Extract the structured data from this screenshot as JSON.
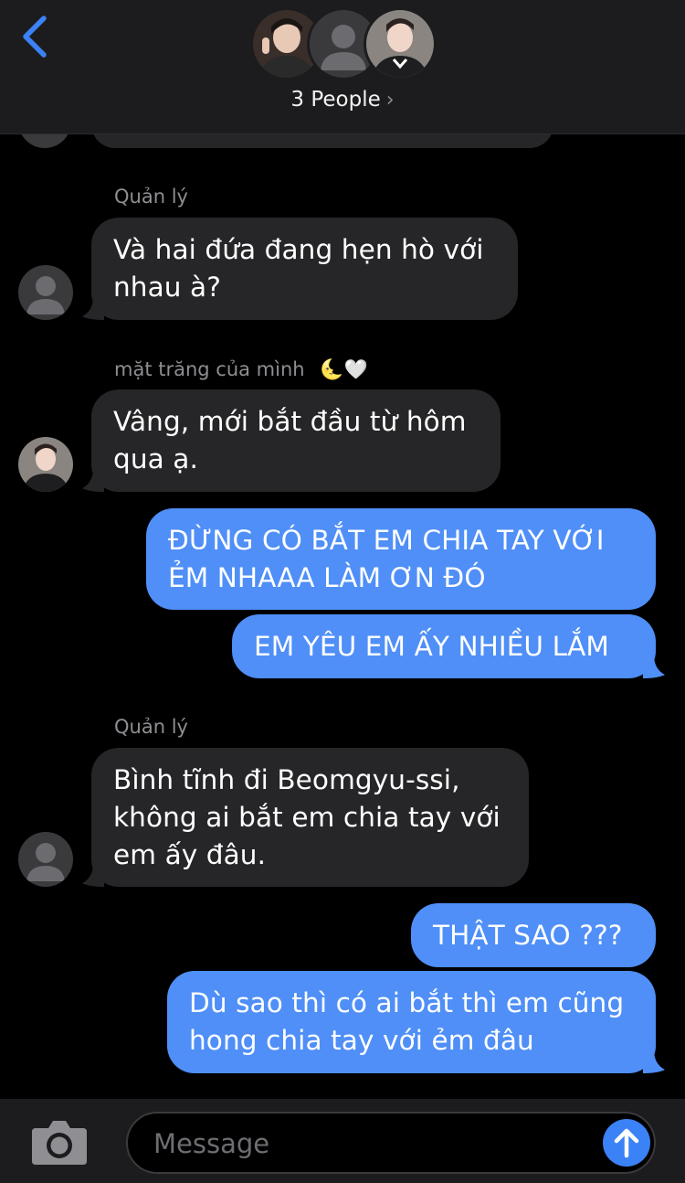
{
  "header": {
    "people_label": "3 People",
    "chevron": "›"
  },
  "messages": {
    "m1_sender": "Quản lý",
    "m1_text": "Và hai đứa đang hẹn hò với nhau à?",
    "m2_sender": "mặt trăng của mình",
    "m2_emoji": "🌜🤍",
    "m2_text": "Vâng, mới bắt đầu từ hôm qua ạ.",
    "m3_text": "ĐỪNG CÓ BẮT EM CHIA TAY VỚI ẺM NHAAA LÀM ƠN ĐÓ",
    "m4_text": "EM YÊU EM ẤY NHIỀU LẮM",
    "m5_sender": "Quản lý",
    "m5_text": "Bình tĩnh đi Beomgyu-ssi, không ai bắt em chia tay với em ấy đâu.",
    "m6_text": "THẬT SAO ???",
    "m7_text": "Dù sao thì có ai bắt thì em cũng hong chia tay với ẻm đâu"
  },
  "composer": {
    "placeholder": "Message"
  },
  "colors": {
    "outgoing_bubble": "#4f8ff7",
    "incoming_bubble": "#262628",
    "accent": "#3b82f6",
    "background": "#000000"
  },
  "icons": [
    "back-chevron-icon",
    "camera-icon",
    "send-arrow-icon",
    "default-avatar-icon"
  ]
}
